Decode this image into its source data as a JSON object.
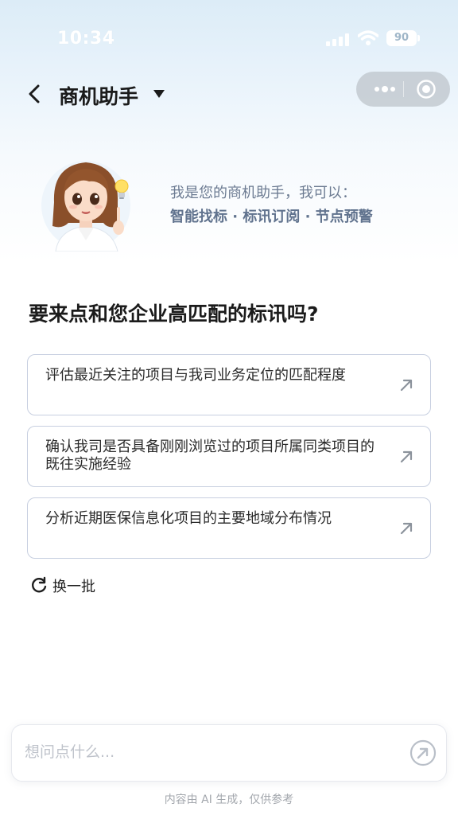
{
  "status_bar": {
    "time": "10:34",
    "battery": "90"
  },
  "nav": {
    "title": "商机助手"
  },
  "intro": {
    "line1": "我是您的商机助手，我可以：",
    "features": "智能找标 · 标讯订阅 · 节点预警"
  },
  "question": "要来点和您企业高匹配的标讯吗?",
  "suggestions": [
    {
      "text": "评估最近关注的项目与我司业务定位的匹配程度"
    },
    {
      "text": "确认我司是否具备刚刚浏览过的项目所属同类项目的既往实施经验"
    },
    {
      "text": "分析近期医保信息化项目的主要地域分布情况"
    }
  ],
  "refresh_label": "换一批",
  "input": {
    "placeholder": "想问点什么...",
    "value": ""
  },
  "disclaimer": "内容由 AI 生成，仅供参考",
  "colors": {
    "accent_text": "#61738e",
    "card_border": "#c7cfe0",
    "icon_gray": "#9aa3ae"
  },
  "icons": [
    "back-icon",
    "caret-down-icon",
    "more-icon",
    "close-capsule-icon",
    "bulb-icon",
    "arrow-up-right-icon",
    "refresh-icon",
    "send-icon"
  ]
}
